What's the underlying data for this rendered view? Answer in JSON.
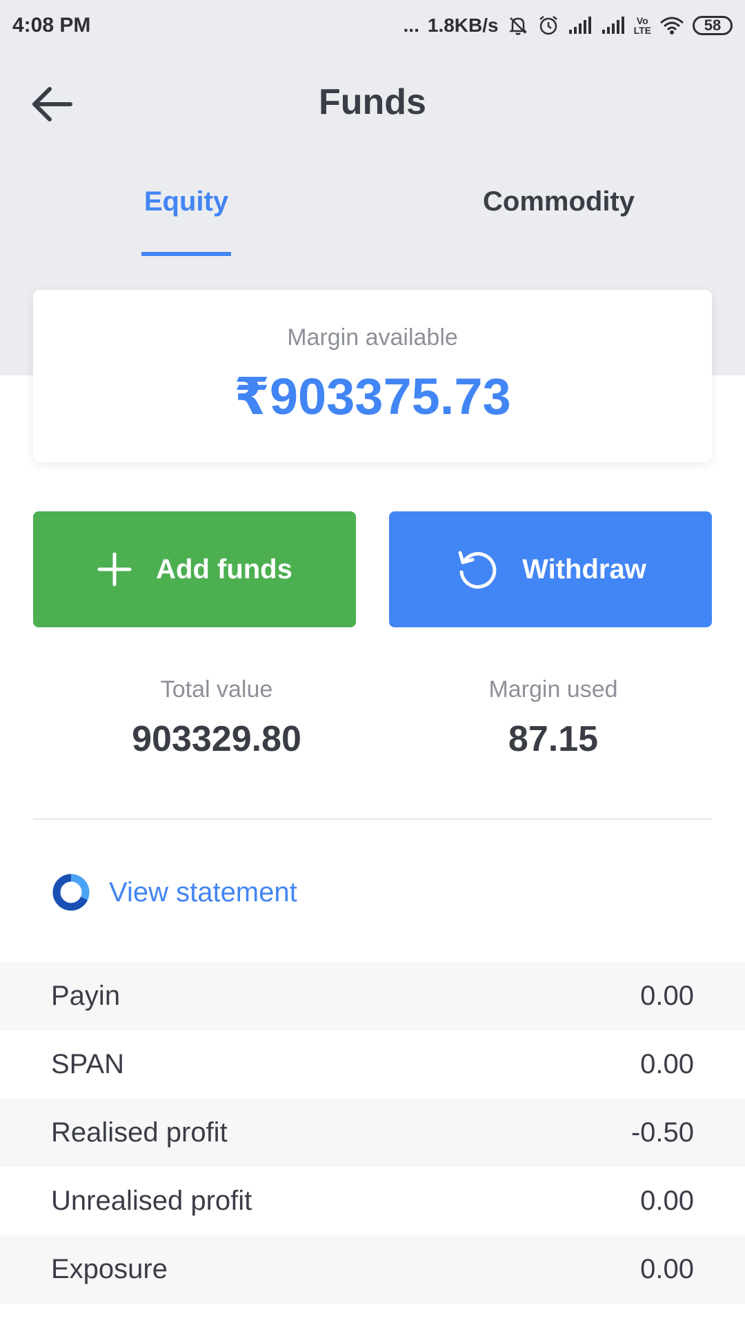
{
  "status_bar": {
    "time": "4:08 PM",
    "dots": "...",
    "network_speed": "1.8KB/s",
    "icons": [
      "mute-icon",
      "alarm-icon",
      "signal-icon",
      "signal-icon",
      "volte-icon",
      "wifi-icon"
    ],
    "volte_label_top": "Vo",
    "volte_label_bottom": "LTE",
    "battery": "58"
  },
  "header": {
    "title": "Funds",
    "back_icon": "arrow-left-icon"
  },
  "tabs": [
    {
      "label": "Equity",
      "active": true
    },
    {
      "label": "Commodity",
      "active": false
    }
  ],
  "margin_card": {
    "label": "Margin available",
    "value": "₹903375.73"
  },
  "actions": {
    "add_label": "Add funds",
    "add_icon": "plus-icon",
    "withdraw_label": "Withdraw",
    "withdraw_icon": "refresh-icon"
  },
  "stats": {
    "total_label": "Total value",
    "total_value": "903329.80",
    "used_label": "Margin used",
    "used_value": "87.15"
  },
  "statement": {
    "label": "View statement",
    "icon": "statement-ring-icon"
  },
  "rows": [
    {
      "label": "Payin",
      "value": "0.00"
    },
    {
      "label": "SPAN",
      "value": "0.00"
    },
    {
      "label": "Realised profit",
      "value": "-0.50"
    },
    {
      "label": "Unrealised profit",
      "value": "0.00"
    },
    {
      "label": "Exposure",
      "value": "0.00"
    }
  ],
  "colors": {
    "accent": "#4285f4",
    "add_button": "#4caf50",
    "header_bg": "#ebecf0",
    "text": "#3a3d46",
    "muted": "#8e9099"
  }
}
